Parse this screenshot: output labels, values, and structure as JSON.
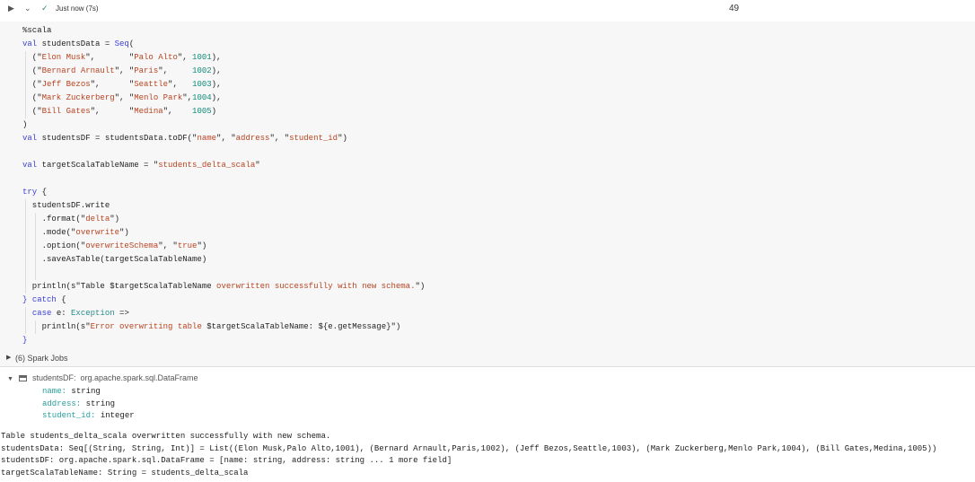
{
  "header": {
    "run_icon": "play-icon",
    "collapse_icon": "chevron-down-icon",
    "status_icon": "check-icon",
    "status": "Just now (7s)",
    "cell_number": "49"
  },
  "code": [
    [
      [
        "pl",
        "%scala"
      ]
    ],
    [
      [
        "kw",
        "val"
      ],
      [
        "pl",
        " studentsData = "
      ],
      [
        "kw",
        "Seq"
      ],
      [
        "pl",
        "("
      ]
    ],
    [
      [
        "pl",
        "  (\""
      ],
      [
        "str",
        "Elon Musk"
      ],
      [
        "pl",
        "\",       \""
      ],
      [
        "str",
        "Palo Alto"
      ],
      [
        "pl",
        "\", "
      ],
      [
        "num2",
        "1001"
      ],
      [
        "pl",
        "),"
      ]
    ],
    [
      [
        "pl",
        "  (\""
      ],
      [
        "str",
        "Bernard Arnault"
      ],
      [
        "pl",
        "\", \""
      ],
      [
        "str",
        "Paris"
      ],
      [
        "pl",
        "\",     "
      ],
      [
        "num2",
        "1002"
      ],
      [
        "pl",
        "),"
      ]
    ],
    [
      [
        "pl",
        "  (\""
      ],
      [
        "str",
        "Jeff Bezos"
      ],
      [
        "pl",
        "\",      \""
      ],
      [
        "str",
        "Seattle"
      ],
      [
        "pl",
        "\",   "
      ],
      [
        "num2",
        "1003"
      ],
      [
        "pl",
        "),"
      ]
    ],
    [
      [
        "pl",
        "  (\""
      ],
      [
        "str",
        "Mark Zuckerberg"
      ],
      [
        "pl",
        "\", \""
      ],
      [
        "str",
        "Menlo Park"
      ],
      [
        "pl",
        "\","
      ],
      [
        "num2",
        "1004"
      ],
      [
        "pl",
        "),"
      ]
    ],
    [
      [
        "pl",
        "  (\""
      ],
      [
        "str",
        "Bill Gates"
      ],
      [
        "pl",
        "\",      \""
      ],
      [
        "str",
        "Medina"
      ],
      [
        "pl",
        "\",    "
      ],
      [
        "num2",
        "1005"
      ],
      [
        "pl",
        ")"
      ]
    ],
    [
      [
        "pl",
        ")"
      ]
    ],
    [
      [
        "kw",
        "val"
      ],
      [
        "pl",
        " studentsDF = studentsData.toDF(\""
      ],
      [
        "str",
        "name"
      ],
      [
        "pl",
        "\", \""
      ],
      [
        "str",
        "address"
      ],
      [
        "pl",
        "\", \""
      ],
      [
        "str",
        "student_id"
      ],
      [
        "pl",
        "\")"
      ]
    ],
    [],
    [
      [
        "kw",
        "val"
      ],
      [
        "pl",
        " targetScalaTableName = \""
      ],
      [
        "str",
        "students_delta_scala"
      ],
      [
        "pl",
        "\""
      ]
    ],
    [],
    [
      [
        "kw",
        "try"
      ],
      [
        "pl",
        " {"
      ]
    ],
    [
      [
        "pl",
        "  studentsDF.write"
      ]
    ],
    [
      [
        "pl",
        "    .format(\""
      ],
      [
        "str",
        "delta"
      ],
      [
        "pl",
        "\")"
      ]
    ],
    [
      [
        "pl",
        "    .mode(\""
      ],
      [
        "str",
        "overwrite"
      ],
      [
        "pl",
        "\")"
      ]
    ],
    [
      [
        "pl",
        "    .option(\""
      ],
      [
        "str",
        "overwriteSchema"
      ],
      [
        "pl",
        "\", \""
      ],
      [
        "str",
        "true"
      ],
      [
        "pl",
        "\")"
      ]
    ],
    [
      [
        "pl",
        "    .saveAsTable(targetScalaTableName)"
      ]
    ],
    [
      [
        "pl",
        "    "
      ]
    ],
    [
      [
        "pl",
        "  println(s\"Table $targetScalaTableName "
      ],
      [
        "str",
        "overwritten successfully with new schema."
      ],
      [
        "pl",
        "\")"
      ]
    ],
    [
      [
        "kw",
        "}"
      ],
      [
        "pl",
        " "
      ],
      [
        "kw",
        "catch"
      ],
      [
        "pl",
        " {"
      ]
    ],
    [
      [
        "pl",
        "  "
      ],
      [
        "kw",
        "case"
      ],
      [
        "pl",
        " e: "
      ],
      [
        "typ",
        "Exception"
      ],
      [
        "pl",
        " =>"
      ]
    ],
    [
      [
        "pl",
        "    println(s\""
      ],
      [
        "str",
        "Error overwriting table"
      ],
      [
        "pl",
        " $targetScalaTableName: ${e.getMessage}\")"
      ]
    ],
    [
      [
        "kw",
        "}"
      ]
    ]
  ],
  "spark_jobs": "(6) Spark Jobs",
  "schema": {
    "name": "studentsDF:",
    "type": "org.apache.spark.sql.DataFrame",
    "fields": [
      {
        "name": "name:",
        "type": "string"
      },
      {
        "name": "address:",
        "type": "string"
      },
      {
        "name": "student_id:",
        "type": "integer"
      }
    ]
  },
  "output": [
    "Table students_delta_scala overwritten successfully with new schema.",
    "studentsData: Seq[(String, String, Int)] = List((Elon Musk,Palo Alto,1001), (Bernard Arnault,Paris,1002), (Jeff Bezos,Seattle,1003), (Mark Zuckerberg,Menlo Park,1004), (Bill Gates,Medina,1005))",
    "studentsDF: org.apache.spark.sql.DataFrame = [name: string, address: string ... 1 more field]",
    "targetScalaTableName: String = students_delta_scala"
  ]
}
